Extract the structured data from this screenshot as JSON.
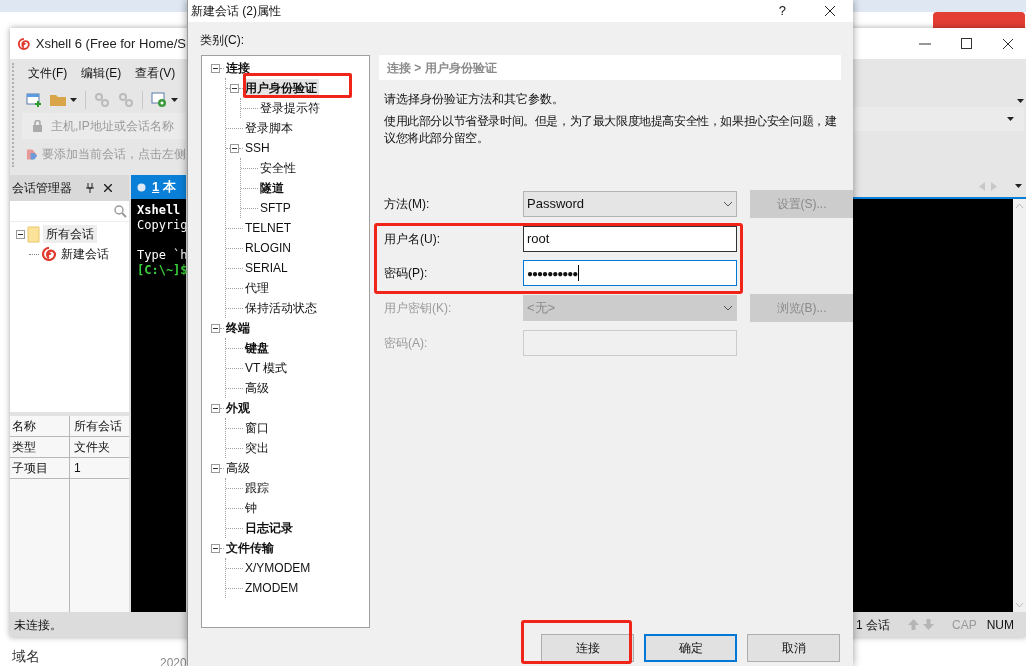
{
  "browser": {
    "bottom_texts": [
      "域名",
      "2020"
    ]
  },
  "xshell": {
    "title": "Xshell 6 (Free for Home/S",
    "menu": [
      "文件(F)",
      "编辑(E)",
      "查看(V)"
    ],
    "address_placeholder": "主机,IP地址或会话名称",
    "hint": "要添加当前会话，点击左侧",
    "session_manager": {
      "title": "会话管理器",
      "tree": [
        {
          "label": "所有会话",
          "expanded": true,
          "selected": true,
          "children": [
            {
              "label": "新建会话",
              "selected": false
            }
          ]
        }
      ]
    },
    "properties": [
      {
        "name": "名称",
        "value": "所有会话"
      },
      {
        "name": "类型",
        "value": "文件夹"
      },
      {
        "name": "子项目",
        "value": "1"
      }
    ],
    "tab": {
      "number": "1",
      "label": "本"
    },
    "terminal_lines": [
      {
        "text": "Xshell",
        "color": "#ffffff",
        "bold": true
      },
      {
        "text": "Copyrig",
        "color": "#ffffff",
        "bold": false
      },
      {
        "text": "Type `h",
        "color": "#ffffff",
        "bold": false,
        "gap_before": true
      },
      {
        "text": "[C:\\~]$",
        "color": "#3bd13b",
        "bold": true
      }
    ],
    "status": "未连接。",
    "status_right": [
      {
        "text": "1 会话",
        "disabled": false
      },
      {
        "text": "CAP",
        "disabled": true
      },
      {
        "text": "NUM",
        "disabled": false
      }
    ]
  },
  "dialog": {
    "title": "新建会话 (2)属性",
    "help": "?",
    "category_label": "类别(C):",
    "tree": [
      {
        "label": "连接",
        "bold": true,
        "selected": false,
        "expanded": true,
        "children": [
          {
            "label": "用户身份验证",
            "bold": true,
            "selected": true,
            "expanded": true,
            "children": [
              {
                "label": "登录提示符",
                "bold": false,
                "selected": false
              }
            ]
          },
          {
            "label": "登录脚本",
            "bold": false,
            "selected": false
          },
          {
            "label": "SSH",
            "bold": false,
            "selected": false,
            "expanded": true,
            "children": [
              {
                "label": "安全性",
                "bold": false,
                "selected": false
              },
              {
                "label": "隧道",
                "bold": true,
                "selected": false
              },
              {
                "label": "SFTP",
                "bold": false,
                "selected": false
              }
            ]
          },
          {
            "label": "TELNET",
            "bold": false,
            "selected": false
          },
          {
            "label": "RLOGIN",
            "bold": false,
            "selected": false
          },
          {
            "label": "SERIAL",
            "bold": false,
            "selected": false
          },
          {
            "label": "代理",
            "bold": false,
            "selected": false
          },
          {
            "label": "保持活动状态",
            "bold": false,
            "selected": false
          }
        ]
      },
      {
        "label": "终端",
        "bold": true,
        "selected": false,
        "expanded": true,
        "children": [
          {
            "label": "键盘",
            "bold": true,
            "selected": false
          },
          {
            "label": "VT 模式",
            "bold": false,
            "selected": false
          },
          {
            "label": "高级",
            "bold": false,
            "selected": false
          }
        ]
      },
      {
        "label": "外观",
        "bold": true,
        "selected": false,
        "expanded": true,
        "children": [
          {
            "label": "窗口",
            "bold": false,
            "selected": false
          },
          {
            "label": "突出",
            "bold": false,
            "selected": false
          }
        ]
      },
      {
        "label": "高级",
        "bold": false,
        "selected": false,
        "expanded": true,
        "children": [
          {
            "label": "跟踪",
            "bold": false,
            "selected": false
          },
          {
            "label": "钟",
            "bold": false,
            "selected": false
          },
          {
            "label": "日志记录",
            "bold": true,
            "selected": false
          }
        ]
      },
      {
        "label": "文件传输",
        "bold": true,
        "selected": false,
        "expanded": true,
        "children": [
          {
            "label": "X/YMODEM",
            "bold": false,
            "selected": false
          },
          {
            "label": "ZMODEM",
            "bold": false,
            "selected": false
          }
        ]
      }
    ],
    "breadcrumb": "连接 > 用户身份验证",
    "intro": "请选择身份验证方法和其它参数。",
    "description": "使用此部分以节省登录时间。但是，为了最大限度地提高安全性，如果担心安全问题，建议您将此部分留空。",
    "fields": [
      {
        "kind": "dropdown",
        "label": "方法(M):",
        "value": "Password",
        "disabled": false,
        "focused": false,
        "button": {
          "label": "设置(S)...",
          "disabled": true
        }
      },
      {
        "kind": "text",
        "label": "用户名(U):",
        "value": "root",
        "disabled": false,
        "focused": false
      },
      {
        "kind": "password",
        "label": "密码(P):",
        "value": "●●●●●●●●●●",
        "disabled": false,
        "focused": true
      },
      {
        "kind": "dropdown",
        "label": "用户密钥(K):",
        "value": "<无>",
        "disabled": true,
        "focused": false,
        "button": {
          "label": "浏览(B)...",
          "disabled": true
        }
      },
      {
        "kind": "text",
        "label": "密码(A):",
        "disabled": true,
        "focused": false
      }
    ],
    "buttons": [
      {
        "label": "连接",
        "focused": false
      },
      {
        "label": "确定",
        "focused": true
      },
      {
        "label": "取消",
        "focused": false
      }
    ]
  }
}
